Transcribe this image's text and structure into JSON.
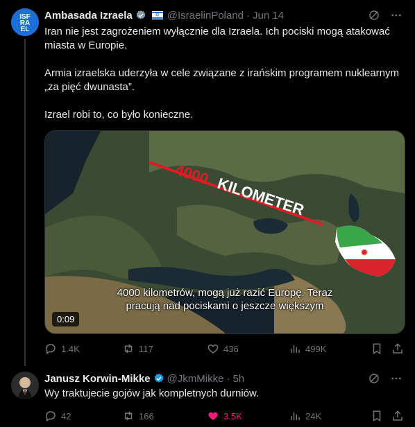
{
  "tweets": [
    {
      "author_name": "Ambasada Izraela",
      "handle": "@IsraelinPoland",
      "date": "Jun 14",
      "separator": "·",
      "avatar_text": [
        "ISF",
        "RA",
        "EL"
      ],
      "paragraphs": [
        "Iran nie jest zagrożeniem wyłącznie dla Izraela. Ich pociski mogą atakować miasta w Europie.",
        "Armia izraelska uderzyła w cele związane z irańskim programem nuklearnym „za pięć dwunasta”.",
        "Izrael robi to, co było konieczne."
      ],
      "media": {
        "overlay_distance": "4000",
        "overlay_unit": "KILOMETER",
        "caption_line1": "4000 kilometrów, mogą już razić Europę. Teraz",
        "caption_line2": "pracują nad pociskami o jeszcze większym",
        "duration": "0:09"
      },
      "stats": {
        "replies": "1.4K",
        "reposts": "117",
        "likes": "436",
        "views": "499K"
      }
    },
    {
      "author_name": "Janusz Korwin-Mikke",
      "handle": "@JkmMikke",
      "date": "5h",
      "separator": "·",
      "paragraphs": [
        "Wy traktujecie gojów jak kompletnych durniów."
      ],
      "stats": {
        "replies": "42",
        "reposts": "166",
        "likes": "3.5K",
        "views": "24K"
      }
    }
  ],
  "colors": {
    "background": "#000000",
    "text": "#e7e9ea",
    "muted": "#71767b",
    "verified": "#1d9bf0",
    "like": "#f91880"
  }
}
